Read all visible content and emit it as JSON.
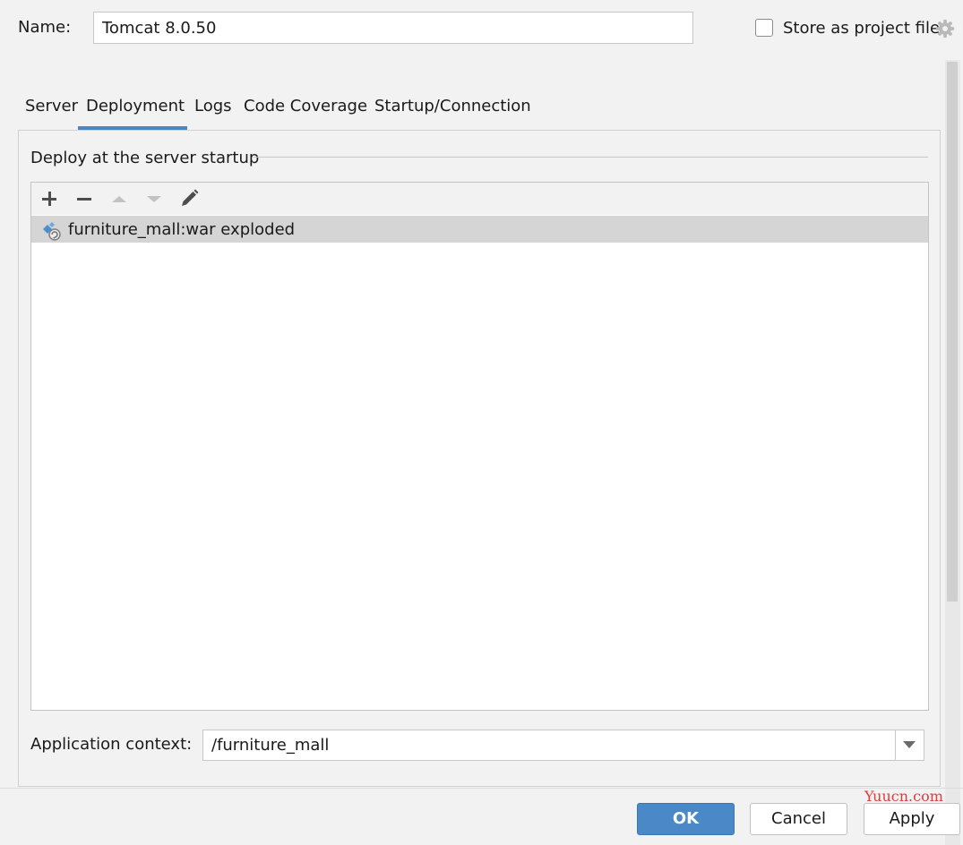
{
  "header": {
    "name_label": "Name:",
    "name_value": "Tomcat 8.0.50",
    "store_label": "Store as project file",
    "store_checked": false,
    "store_icon": "gear-icon"
  },
  "tabs": [
    {
      "label": "Server",
      "active": false
    },
    {
      "label": "Deployment",
      "active": true
    },
    {
      "label": "Logs",
      "active": false
    },
    {
      "label": "Code Coverage",
      "active": false
    },
    {
      "label": "Startup/Connection",
      "active": false
    }
  ],
  "deployment": {
    "section_title": "Deploy at the server startup",
    "toolbar": [
      {
        "icon": "plus-icon",
        "enabled": true
      },
      {
        "icon": "minus-icon",
        "enabled": true
      },
      {
        "icon": "arrow-up-icon",
        "enabled": false
      },
      {
        "icon": "arrow-down-icon",
        "enabled": false
      },
      {
        "icon": "pencil-icon",
        "enabled": true
      }
    ],
    "artifacts": [
      {
        "label": "furniture_mall:war exploded",
        "icon": "artifact-icon",
        "selected": true
      }
    ],
    "context_label": "Application context:",
    "context_value": "/furniture_mall"
  },
  "buttons": {
    "ok": "OK",
    "cancel": "Cancel",
    "apply": "Apply"
  },
  "watermark": "Yuucn.com",
  "colors": {
    "accent": "#4a88c7",
    "selected_row": "#d5d5d5",
    "background": "#f2f2f2",
    "watermark": "#e03c3c"
  }
}
